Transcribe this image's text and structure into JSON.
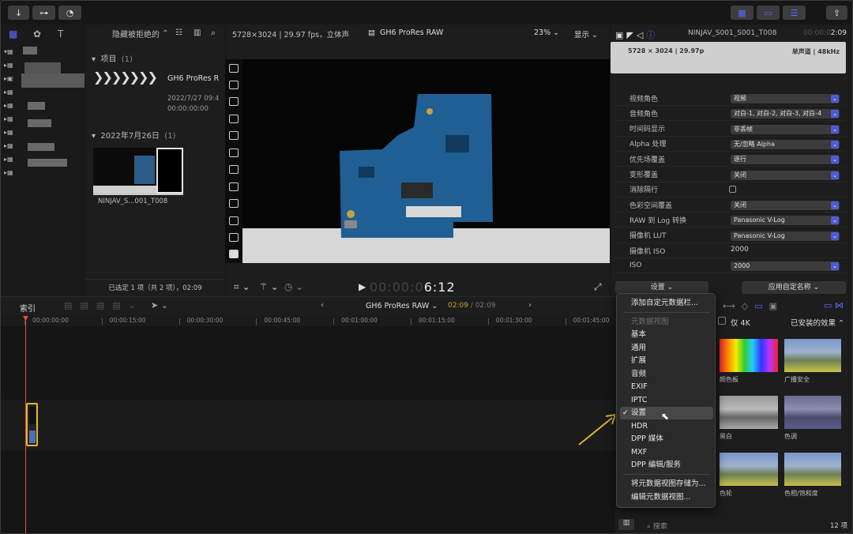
{
  "toolbar": {
    "import_icon": "↓",
    "keyword_icon": "⊶",
    "bg_icon": "◔"
  },
  "browser": {
    "filter_label": "隐藏被拒绝的",
    "section_project": "项目",
    "section_project_count": "(1)",
    "project_name": "GH6 ProRes R",
    "project_date": "2022/7/27 09:4",
    "project_time": "00:00:00:00",
    "section_date": "2022年7月26日",
    "section_date_count": "(1)",
    "clip_name": "NINJAV_S...001_T008",
    "status": "已选定 1 项（共 2 项），02:09"
  },
  "viewer": {
    "info": "5728×3024 | 29.97 fps，立体声",
    "codec": "GH6 ProRes RAW",
    "zoom": "23%",
    "display": "显示",
    "timecode_dim": "00:00:0",
    "timecode": "6:12"
  },
  "inspector": {
    "clip_title": "NINJAV_S001_S001_T008",
    "clip_time_dim": "00:00:0",
    "clip_time": "2:09",
    "res": "5728 × 3024 | 29.97p",
    "audio": "单声道 | 48kHz",
    "rows": [
      {
        "label": "视频角色",
        "value": "视频",
        "type": "select"
      },
      {
        "label": "音频角色",
        "value": "对白-1, 对白-2, 对白-3, 对白-4",
        "type": "select"
      },
      {
        "label": "时间码显示",
        "value": "非丢帧",
        "type": "select"
      },
      {
        "label": "Alpha 处理",
        "value": "无/忽略 Alpha",
        "type": "select"
      },
      {
        "label": "优先场覆盖",
        "value": "逐行",
        "type": "select"
      },
      {
        "label": "变形覆盖",
        "value": "关闭",
        "type": "select"
      },
      {
        "label": "消除隔行",
        "value": "",
        "type": "checkbox"
      },
      {
        "label": "色彩空间覆盖",
        "value": "关闭",
        "type": "select"
      },
      {
        "label": "RAW 到 Log 转换",
        "value": "Panasonic V-Log",
        "type": "select"
      },
      {
        "label": "摄像机 LUT",
        "value": "Panasonic V-Log",
        "type": "select"
      },
      {
        "label": "摄像机 ISO",
        "value": "2000",
        "type": "text"
      },
      {
        "label": "ISO",
        "value": "2000",
        "type": "select"
      }
    ],
    "settings_btn": "设置 ⌄",
    "apply_btn": "应用自定名称 ⌄"
  },
  "timeline": {
    "index": "索引",
    "project": "GH6 ProRes RAW",
    "time_cur": "02:09",
    "time_total": "02:09",
    "ticks": [
      "00:00:00:00",
      "00:00:15:00",
      "00:00:30:00",
      "00:00:45:00",
      "00:01:00:00",
      "00:01:15:00",
      "00:01:30:00",
      "00:01:45:00"
    ]
  },
  "menu": {
    "items": [
      {
        "label": "添加自定元数据栏...",
        "state": "normal"
      },
      {
        "label": "元数据视图",
        "state": "disabled"
      },
      {
        "label": "基本",
        "state": "normal"
      },
      {
        "label": "通用",
        "state": "normal"
      },
      {
        "label": "扩展",
        "state": "normal"
      },
      {
        "label": "音频",
        "state": "normal"
      },
      {
        "label": "EXIF",
        "state": "normal"
      },
      {
        "label": "IPTC",
        "state": "normal"
      },
      {
        "label": "设置",
        "state": "checked"
      },
      {
        "label": "HDR",
        "state": "normal"
      },
      {
        "label": "DPP 媒体",
        "state": "normal"
      },
      {
        "label": "MXF",
        "state": "normal"
      },
      {
        "label": "DPP 编辑/服务",
        "state": "normal"
      },
      {
        "label": "将元数据视图存储为...",
        "state": "normal"
      },
      {
        "label": "编辑元数据视图...",
        "state": "normal"
      }
    ]
  },
  "effects": {
    "only4k": "仅 4K",
    "installed": "已安装的效果",
    "items": [
      "颜色板",
      "广播安全",
      "黑白",
      "色调",
      "色轮",
      "色相/饱和度"
    ],
    "search_placeholder": "搜索",
    "count": "12 项"
  },
  "colors": {
    "accent": "#4d5bd8",
    "playhead": "#e0533c",
    "clip_border": "#e0b52e",
    "arrow": "#d9b230"
  }
}
